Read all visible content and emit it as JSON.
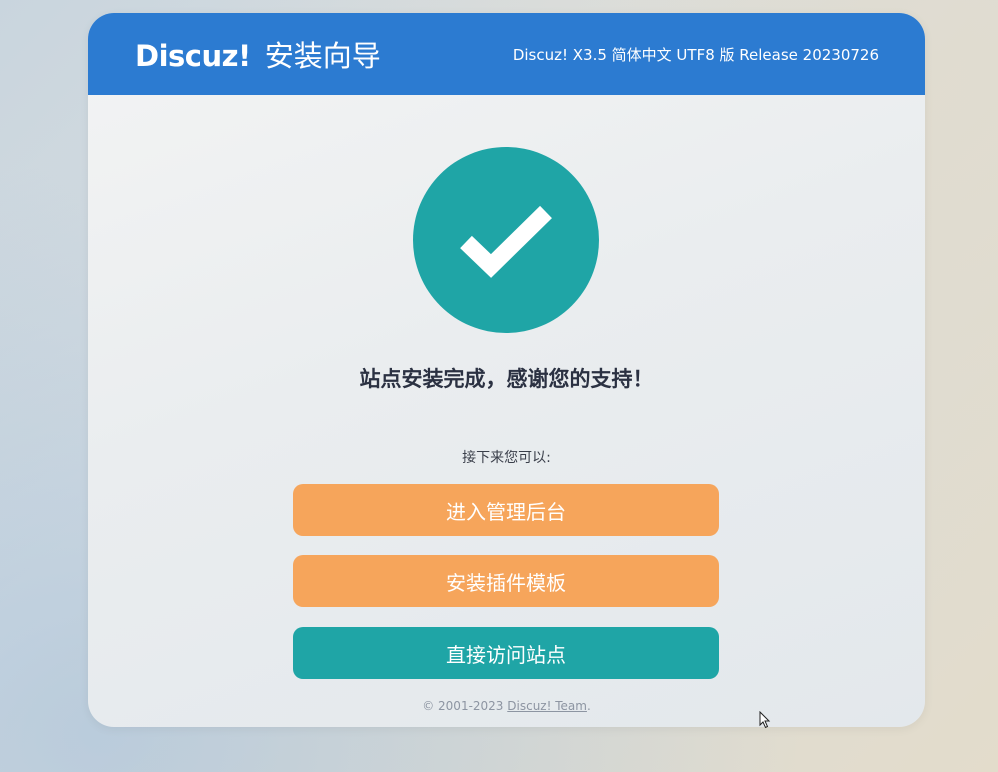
{
  "header": {
    "brand": "Discuz!",
    "subtitle": "安装向导",
    "version": "Discuz! X3.5 简体中文 UTF8 版 Release 20230726"
  },
  "status": {
    "icon": "checkmark-icon",
    "message": "站点安装完成，感谢您的支持！"
  },
  "next_steps": {
    "label": "接下来您可以:",
    "actions": [
      {
        "label": "进入管理后台",
        "color": "#f6a55b"
      },
      {
        "label": "安装插件模板",
        "color": "#f6a55b"
      },
      {
        "label": "直接访问站点",
        "color": "#1fa5a6"
      }
    ]
  },
  "footer": {
    "copyright": "© 2001-2023 ",
    "team_link": "Discuz! Team",
    "suffix": "."
  },
  "colors": {
    "header": "#2c7bd1",
    "success": "#1fa5a6",
    "orange": "#f6a55b"
  }
}
